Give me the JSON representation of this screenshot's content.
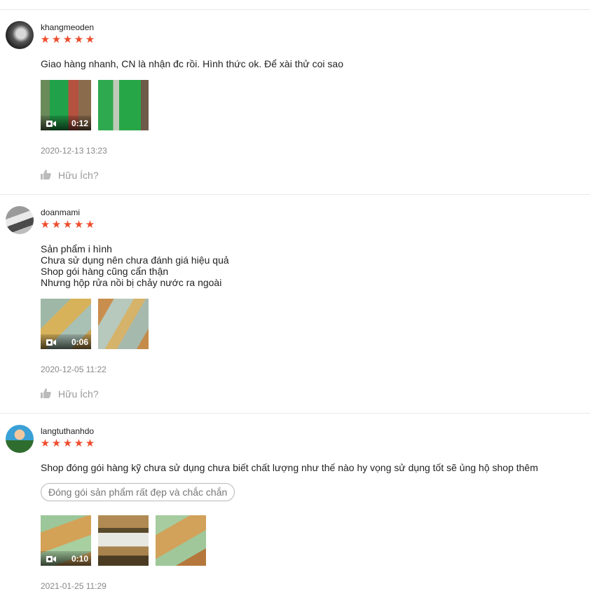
{
  "reviews": [
    {
      "username": "khangmeoden",
      "stars": [
        "★",
        "★",
        "★",
        "★",
        "★"
      ],
      "comment_lines": [
        "Giao hàng nhanh, CN là nhận đc rồi. Hình thức ok. Để xài thử coi sao"
      ],
      "video_duration": "0:12",
      "date": "2020-12-13 13:23",
      "helpful_label": "Hữu Ích?"
    },
    {
      "username": "doanmami",
      "stars": [
        "★",
        "★",
        "★",
        "★",
        "★"
      ],
      "comment_lines": [
        "Sản phẩm i hình",
        "Chưa sử dụng nên chưa đánh giá hiệu quả",
        "Shop gói hàng cũng cẩn thận",
        "Nhưng hộp rửa nồi bị chảy nước ra ngoài"
      ],
      "video_duration": "0:06",
      "date": "2020-12-05 11:22",
      "helpful_label": "Hữu Ích?"
    },
    {
      "username": "langtuthanhdo",
      "stars": [
        "★",
        "★",
        "★",
        "★",
        "★"
      ],
      "comment_lines": [
        "Shop đóng gói hàng kỹ chưa sử dụng chưa biết chất lượng như thế nào hy vọng sử dụng tốt sẽ ủng hộ shop thêm"
      ],
      "tag": "Đóng gói sản phẩm rất đẹp và chắc chắn",
      "video_duration": "0:10",
      "date": "2021-01-25 11:29"
    }
  ],
  "colors": {
    "star": "#ee4d2d",
    "muted_text": "#888888",
    "divider": "#e8e8e8"
  },
  "icons": {
    "video": "video-camera-icon",
    "helpful": "thumbs-up-icon"
  }
}
